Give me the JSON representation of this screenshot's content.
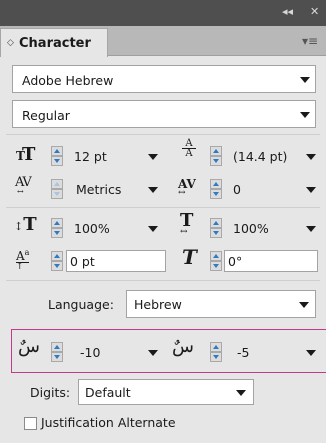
{
  "titlebar": {
    "collapse_glyph": "◂◂",
    "close_glyph": "✕"
  },
  "tab": {
    "label": "Character",
    "chevron_glyph": "◇",
    "menu_glyph": "▾≡"
  },
  "font_family": {
    "value": "Adobe Hebrew"
  },
  "font_style": {
    "value": "Regular"
  },
  "font_size": {
    "value": "12 pt"
  },
  "leading": {
    "value": "(14.4 pt)"
  },
  "kerning": {
    "value": "Metrics"
  },
  "tracking": {
    "value": "0"
  },
  "vertical_scale": {
    "value": "100%"
  },
  "horizontal_scale": {
    "value": "100%"
  },
  "baseline_shift": {
    "value": "0 pt"
  },
  "skew": {
    "value": "0°"
  },
  "language": {
    "label": "Language:",
    "value": "Hebrew"
  },
  "diacritics": {
    "x_offset": "-10",
    "y_offset": "-5",
    "x_icon_glyph": "سٌ",
    "y_icon_glyph": "سٌ"
  },
  "digits": {
    "label": "Digits:",
    "value": "Default"
  },
  "justification_alternate": {
    "label": "Justification Alternate",
    "checked": false
  },
  "colors": {
    "highlight_border": "#c2398e",
    "stepper_arrow": "#2f7ac3",
    "titlebar": "#4f4f4f"
  }
}
